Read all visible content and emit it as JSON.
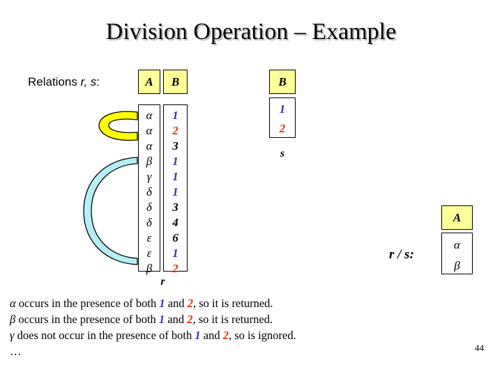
{
  "slide": {
    "title": "Division Operation – Example",
    "number": "44",
    "relations_label_prefix": "Relations ",
    "relations_label_italic": "r, s",
    "relations_label_suffix": ":"
  },
  "relation_r": {
    "name": "r",
    "headers": [
      "A",
      "B"
    ],
    "rows": [
      {
        "a": "α",
        "b": "1",
        "b_color": "blue"
      },
      {
        "a": "α",
        "b": "2",
        "b_color": "red"
      },
      {
        "a": "α",
        "b": "3",
        "b_color": "black"
      },
      {
        "a": "β",
        "b": "1",
        "b_color": "blue"
      },
      {
        "a": "γ",
        "b": "1",
        "b_color": "blue"
      },
      {
        "a": "δ",
        "b": "1",
        "b_color": "blue"
      },
      {
        "a": "δ",
        "b": "3",
        "b_color": "black"
      },
      {
        "a": "δ",
        "b": "4",
        "b_color": "black"
      },
      {
        "a": "ε",
        "b": "6",
        "b_color": "black"
      },
      {
        "a": "ε",
        "b": "1",
        "b_color": "blue"
      },
      {
        "a": "β",
        "b": "2",
        "b_color": "red"
      }
    ]
  },
  "relation_s": {
    "name": "s",
    "headers": [
      "B"
    ],
    "rows": [
      {
        "b": "1",
        "b_color": "blue"
      },
      {
        "b": "2",
        "b_color": "red"
      }
    ]
  },
  "result": {
    "label": "r / s:",
    "headers": [
      "A"
    ],
    "rows": [
      {
        "a": "α"
      },
      {
        "a": "β"
      }
    ]
  },
  "notes": [
    {
      "greek": "α",
      "part1": " occurs in the presence of both ",
      "n1": "1",
      "mid": " and ",
      "n2": "2",
      "part2": ", so it is returned."
    },
    {
      "greek": "β",
      "part1": " occurs in the presence of both ",
      "n1": "1",
      "mid": " and ",
      "n2": "2",
      "part2": ", so it is returned."
    },
    {
      "greek": "γ",
      "part1": " does not occur in the presence of both ",
      "n1": "1",
      "mid": " and ",
      "n2": "2",
      "part2": ", so is ignored."
    }
  ],
  "notes_ellipsis": "…",
  "colors": {
    "header_fill": "#ffff99",
    "number_blue": "#3333aa",
    "number_red": "#dd3311",
    "arc_yellow": "#ffff00",
    "arc_cyan": "#b5eef5",
    "outline": "#000000",
    "title_shadow": "#b8b8b8"
  },
  "arcs": [
    {
      "name": "alpha-group-arc",
      "color": "#ffff00",
      "connects": "rows 1-2"
    },
    {
      "name": "beta-group-arc",
      "color": "#b5eef5",
      "connects": "rows 4-11"
    }
  ]
}
